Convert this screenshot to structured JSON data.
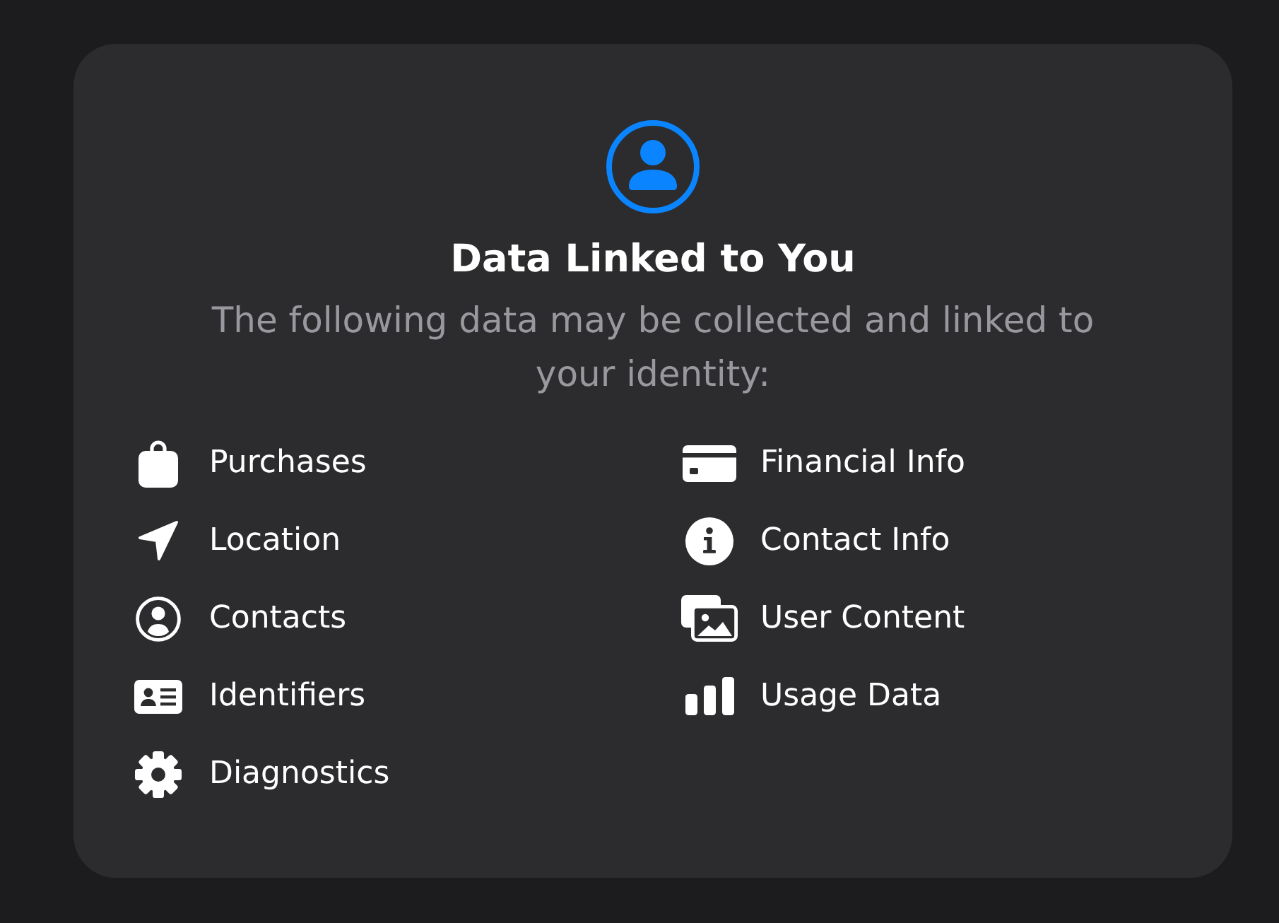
{
  "header": {
    "title": "Data Linked to You",
    "description": "The following data may be collected and linked to your identity:"
  },
  "columns": [
    {
      "items": [
        {
          "label": "Purchases",
          "kind": "bag"
        },
        {
          "label": "Location",
          "kind": "arrow"
        },
        {
          "label": "Contacts",
          "kind": "person"
        },
        {
          "label": "Identifiers",
          "kind": "idcard"
        },
        {
          "label": "Diagnostics",
          "kind": "gear"
        }
      ]
    },
    {
      "items": [
        {
          "label": "Financial Info",
          "kind": "creditcard"
        },
        {
          "label": "Contact Info",
          "kind": "info"
        },
        {
          "label": "User Content",
          "kind": "photos"
        },
        {
          "label": "Usage Data",
          "kind": "bars"
        }
      ]
    }
  ]
}
